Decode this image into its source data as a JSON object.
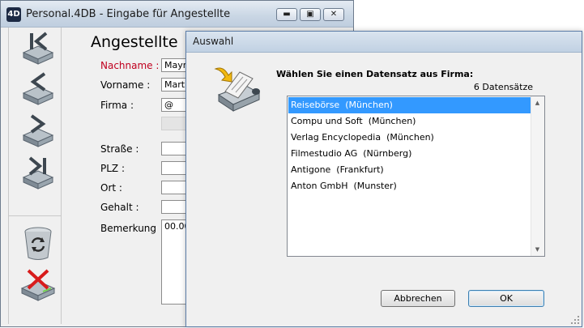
{
  "main_window": {
    "app_icon": "4D",
    "title": "Personal.4DB - Eingabe für Angestellte",
    "caption_buttons": {
      "minimize": "▬",
      "maximize": "▣",
      "close": "✕"
    },
    "form_title": "Angestellte",
    "nav_buttons": [
      "first-record-icon",
      "previous-record-icon",
      "next-record-icon",
      "last-record-icon",
      "trash-icon",
      "delete-record-icon"
    ],
    "fields": {
      "nachname": {
        "label": "Nachname :",
        "value": "Mayr"
      },
      "vorname": {
        "label": "Vorname :",
        "value": "Martin"
      },
      "firma": {
        "label": "Firma :",
        "value": "@"
      },
      "strasse": {
        "label": "Straße :",
        "value": ""
      },
      "plz": {
        "label": "PLZ :",
        "value": ""
      },
      "ort": {
        "label": "Ort :",
        "value": ""
      },
      "gehalt": {
        "label": "Gehalt :",
        "value": ""
      },
      "bemerkung": {
        "label": "Bemerkung",
        "value": "00.00"
      }
    }
  },
  "dialog": {
    "title": "Auswahl",
    "icon": "printer-paper-icon",
    "prompt": "Wählen Sie einen Datensatz aus Firma:",
    "record_count": "6 Datensätze",
    "selected_index": 0,
    "items": [
      "Reisebörse  (München)",
      "Compu und Soft  (München)",
      "Verlag Encyclopedia  (München)",
      "Filmestudio AG  (Nürnberg)",
      "Antigone  (Frankfurt)",
      "Anton GmbH  (Munster)"
    ],
    "scroll_up": "▲",
    "scroll_down": "▼",
    "cancel_label": "Abbrechen",
    "ok_label": "OK"
  },
  "colors": {
    "selection": "#3399ff",
    "required_label": "#c0001f",
    "titlebar": "#c9d6e4"
  }
}
